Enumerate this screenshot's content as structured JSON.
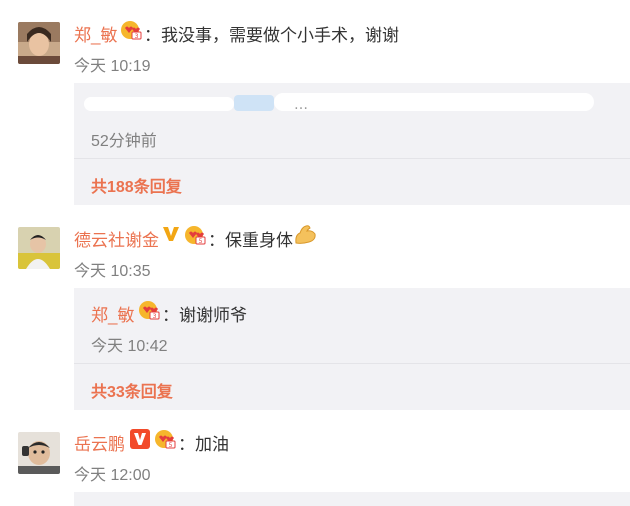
{
  "comments": [
    {
      "name": "郑_敏",
      "text": "：我没事，需要做个小手术，谢谢",
      "time": "今天 10:19",
      "reply_box": {
        "time": "52分钟前",
        "count": "共188条回复"
      }
    },
    {
      "name": "德云社谢金",
      "text": "：保重身体",
      "time": "今天 10:35",
      "reply_box": {
        "reply_name": "郑_敏",
        "reply_text": "：谢谢师爷",
        "reply_time": "今天 10:42",
        "count": "共33条回复"
      }
    },
    {
      "name": "岳云鹏",
      "text": "：加油",
      "time": "今天 12:00"
    }
  ],
  "colors": {
    "name": "#eb7350",
    "text": "#333333",
    "time": "#808080",
    "box_bg": "#f2f2f5"
  },
  "icons": [
    "heart-face-badge-icon",
    "verified-v-yellow-icon",
    "verified-v-red-icon",
    "flexed-arm-emoji-icon"
  ]
}
